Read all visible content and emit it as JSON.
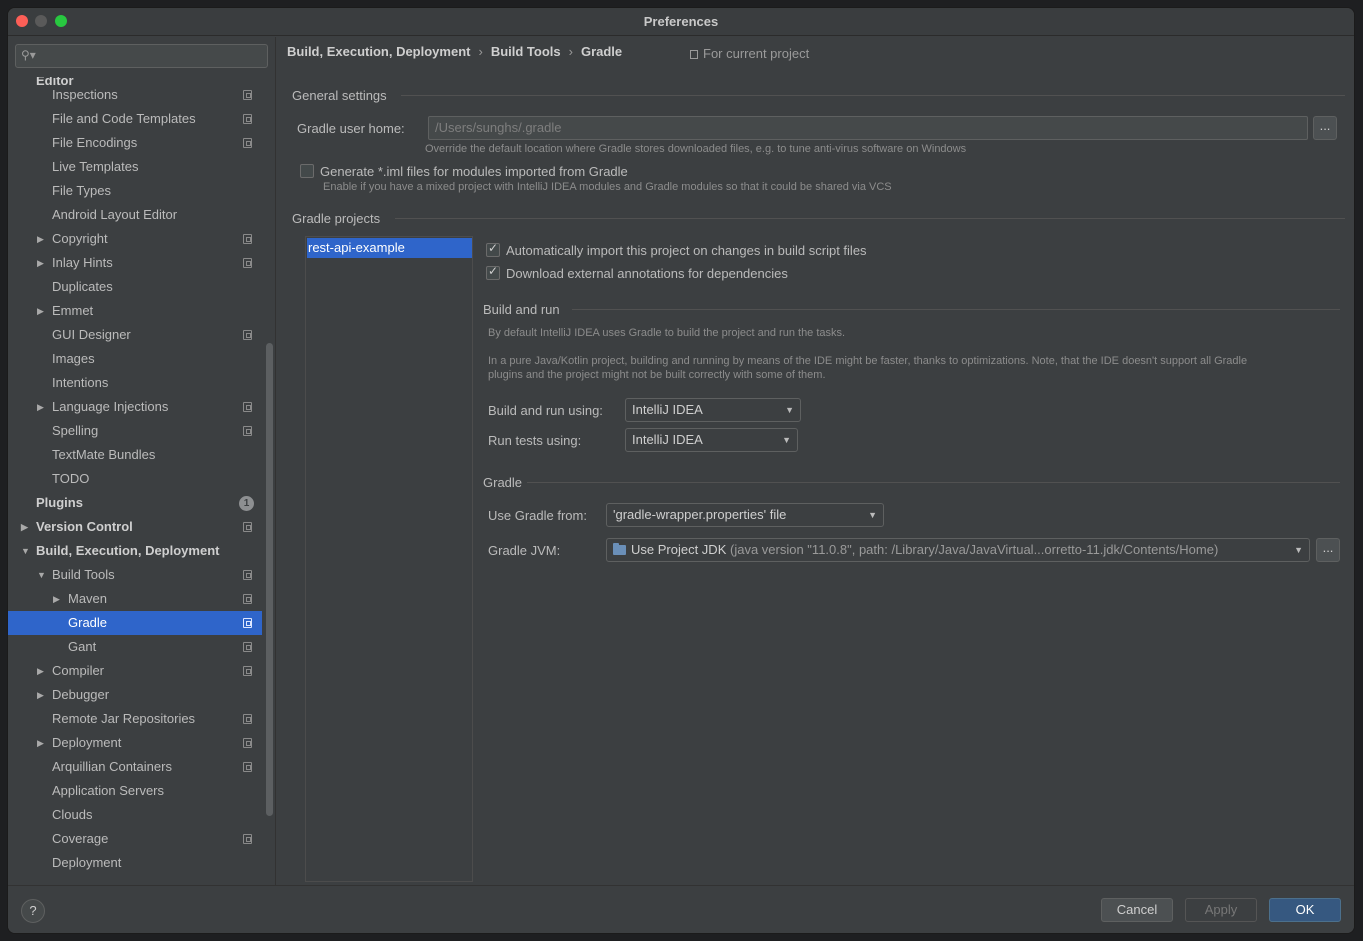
{
  "window": {
    "title": "Preferences"
  },
  "search": {
    "placeholder": ""
  },
  "tree": [
    {
      "label": "Editor",
      "depth": 0,
      "bold": true,
      "arrow": "",
      "proj": false
    },
    {
      "label": "Inspections",
      "depth": 1,
      "arrow": "",
      "proj": true
    },
    {
      "label": "File and Code Templates",
      "depth": 1,
      "arrow": "",
      "proj": true
    },
    {
      "label": "File Encodings",
      "depth": 1,
      "arrow": "",
      "proj": true
    },
    {
      "label": "Live Templates",
      "depth": 1,
      "arrow": "",
      "proj": false
    },
    {
      "label": "File Types",
      "depth": 1,
      "arrow": "",
      "proj": false
    },
    {
      "label": "Android Layout Editor",
      "depth": 1,
      "arrow": "",
      "proj": false
    },
    {
      "label": "Copyright",
      "depth": 1,
      "arrow": "right",
      "proj": true
    },
    {
      "label": "Inlay Hints",
      "depth": 1,
      "arrow": "right",
      "proj": true
    },
    {
      "label": "Duplicates",
      "depth": 1,
      "arrow": "",
      "proj": false
    },
    {
      "label": "Emmet",
      "depth": 1,
      "arrow": "right",
      "proj": false
    },
    {
      "label": "GUI Designer",
      "depth": 1,
      "arrow": "",
      "proj": true
    },
    {
      "label": "Images",
      "depth": 1,
      "arrow": "",
      "proj": false
    },
    {
      "label": "Intentions",
      "depth": 1,
      "arrow": "",
      "proj": false
    },
    {
      "label": "Language Injections",
      "depth": 1,
      "arrow": "right",
      "proj": true
    },
    {
      "label": "Spelling",
      "depth": 1,
      "arrow": "",
      "proj": true
    },
    {
      "label": "TextMate Bundles",
      "depth": 1,
      "arrow": "",
      "proj": false
    },
    {
      "label": "TODO",
      "depth": 1,
      "arrow": "",
      "proj": false
    },
    {
      "label": "Plugins",
      "depth": 0,
      "bold": true,
      "arrow": "",
      "proj": false,
      "badge": "1"
    },
    {
      "label": "Version Control",
      "depth": 0,
      "bold": true,
      "arrow": "right",
      "proj": true
    },
    {
      "label": "Build, Execution, Deployment",
      "depth": 0,
      "bold": true,
      "arrow": "down",
      "proj": false
    },
    {
      "label": "Build Tools",
      "depth": 1,
      "arrow": "down",
      "proj": true
    },
    {
      "label": "Maven",
      "depth": 2,
      "arrow": "right",
      "proj": true
    },
    {
      "label": "Gradle",
      "depth": 2,
      "arrow": "",
      "proj": true,
      "selected": true
    },
    {
      "label": "Gant",
      "depth": 2,
      "arrow": "",
      "proj": true
    },
    {
      "label": "Compiler",
      "depth": 1,
      "arrow": "right",
      "proj": true
    },
    {
      "label": "Debugger",
      "depth": 1,
      "arrow": "right",
      "proj": false
    },
    {
      "label": "Remote Jar Repositories",
      "depth": 1,
      "arrow": "",
      "proj": true
    },
    {
      "label": "Deployment",
      "depth": 1,
      "arrow": "right",
      "proj": true
    },
    {
      "label": "Arquillian Containers",
      "depth": 1,
      "arrow": "",
      "proj": true
    },
    {
      "label": "Application Servers",
      "depth": 1,
      "arrow": "",
      "proj": false
    },
    {
      "label": "Clouds",
      "depth": 1,
      "arrow": "",
      "proj": false
    },
    {
      "label": "Coverage",
      "depth": 1,
      "arrow": "",
      "proj": true
    },
    {
      "label": "Deployment",
      "depth": 1,
      "arrow": "",
      "proj": false
    }
  ],
  "breadcrumb": {
    "items": [
      "Build, Execution, Deployment",
      "Build Tools",
      "Gradle"
    ],
    "separator": "›",
    "scope": "For current project"
  },
  "general": {
    "heading": "General settings",
    "user_home_label": "Gradle user home:",
    "user_home_value": "/Users/sunghs/.gradle",
    "user_home_hint": "Override the default location where Gradle stores downloaded files, e.g. to tune anti-virus software on Windows",
    "browse_label": "...",
    "iml_label": "Generate *.iml files for modules imported from Gradle",
    "iml_checked": false,
    "iml_hint": "Enable if you have a mixed project with IntelliJ IDEA modules and Gradle modules so that it could be shared via VCS"
  },
  "projects": {
    "heading": "Gradle projects",
    "list": [
      "rest-api-example"
    ],
    "auto_import_label": "Automatically import this project on changes in build script files",
    "auto_import_checked": true,
    "annotations_label": "Download external annotations for dependencies",
    "annotations_checked": true
  },
  "build_run": {
    "heading": "Build and run",
    "desc1": "By default IntelliJ IDEA uses Gradle to build the project and run the tasks.",
    "desc2a": "In a pure Java/Kotlin project, building and running by means of the IDE might be faster, thanks to optimizations. Note, that the IDE doesn't support all Gradle",
    "desc2b": "plugins and the project might not be built correctly with some of them.",
    "build_using_label": "Build and run using:",
    "build_using_value": "IntelliJ IDEA",
    "tests_using_label": "Run tests using:",
    "tests_using_value": "IntelliJ IDEA"
  },
  "gradle": {
    "heading": "Gradle",
    "use_from_label": "Use Gradle from:",
    "use_from_value": "'gradle-wrapper.properties' file",
    "jvm_label": "Gradle JVM:",
    "jvm_value": "Use Project JDK",
    "jvm_detail": "(java version \"11.0.8\", path: /Library/Java/JavaVirtual...orretto-11.jdk/Contents/Home)",
    "jvm_browse": "..."
  },
  "footer": {
    "help": "?",
    "cancel": "Cancel",
    "apply": "Apply",
    "ok": "OK"
  },
  "colors": {
    "accent": "#2f65ca",
    "ok_button": "#365880",
    "panel": "#3c3f41"
  }
}
